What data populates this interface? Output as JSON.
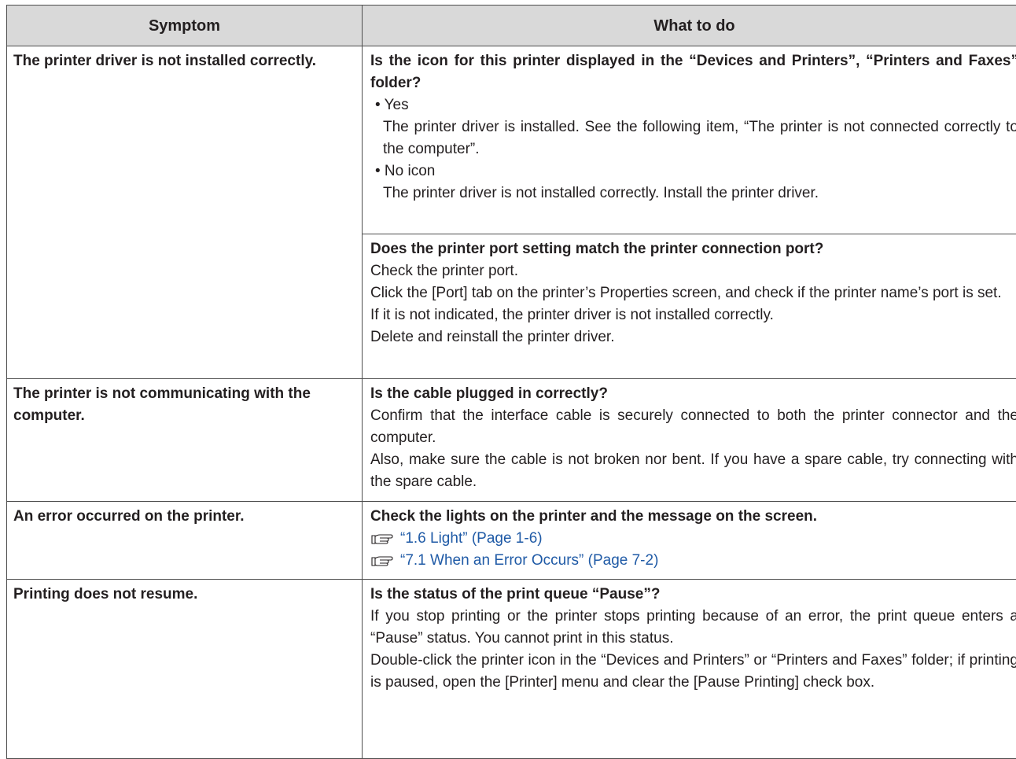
{
  "table": {
    "headers": {
      "symptom": "Symptom",
      "what_to_do": "What to do"
    },
    "rows": [
      {
        "symptom": "The printer driver is not installed correctly.",
        "blocks": [
          {
            "question": "Is the icon for this printer displayed in the “Devices and Printers”, “Printers and Faxes” folder?",
            "yes_label": "• Yes",
            "yes_text": "The printer driver is installed. See the following item, “The printer is not connected correctly to the computer”.",
            "no_label": "• No icon",
            "no_text": "The printer driver is not installed correctly. Install the printer driver."
          },
          {
            "question": "Does the printer port setting match the printer connection port?",
            "lines": [
              "Check the printer port.",
              "Click the [Port] tab on the printer’s Properties screen, and check if the printer name’s port is set.",
              "If it is not indicated, the printer driver is not installed correctly.",
              "Delete and reinstall the printer driver."
            ]
          }
        ]
      },
      {
        "symptom": "The printer is not communicating with the computer.",
        "question": "Is the cable plugged in correctly?",
        "lines": [
          "Confirm that the interface cable is securely connected to both the printer connector and the computer.",
          "Also, make sure the cable is not broken nor bent. If you have a spare cable, try connecting with the spare cable."
        ]
      },
      {
        "symptom": "An error occurred on the printer.",
        "question": "Check the lights on the printer and the message on the screen.",
        "links": [
          {
            "icon": "reference-hand-icon",
            "text": "“1.6 Light” (Page 1-6)"
          },
          {
            "icon": "reference-hand-icon",
            "text": "“7.1 When an Error Occurs” (Page 7-2)"
          }
        ]
      },
      {
        "symptom": "Printing does not resume.",
        "question": "Is the status of the print queue “Pause”?",
        "lines": [
          "If you stop printing or the printer stops printing because of an error, the print queue enters a “Pause” status. You cannot print in this status.",
          "Double-click the printer icon in the “Devices and Printers” or “Printers and Faxes” folder; if printing is paused, open the [Printer] menu and clear the [Pause Printing] check box."
        ]
      }
    ]
  },
  "colors": {
    "header_bg": "#d9d9d9",
    "border": "#4d4d4d",
    "link": "#1f5aa6",
    "text": "#231f20"
  }
}
